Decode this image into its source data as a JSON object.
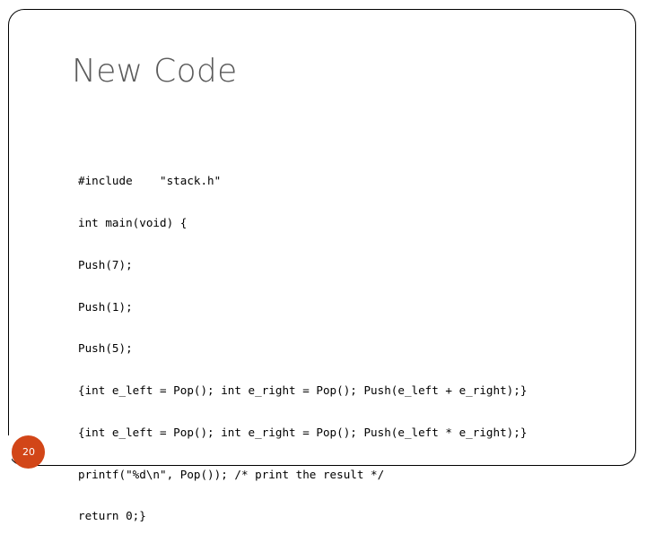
{
  "slide": {
    "title": "New Code",
    "page_number": "20",
    "accent_color": "#D24618",
    "title_color": "#5a5a5a",
    "background_color": "#ffffff",
    "border_color": "#000000"
  },
  "code": {
    "language": "c",
    "lines": [
      "#include    \"stack.h\"",
      "int main(void) {",
      "Push(7);",
      "Push(1);",
      "Push(5);",
      "{int e_left = Pop(); int e_right = Pop(); Push(e_left + e_right);}",
      "{int e_left = Pop(); int e_right = Pop(); Push(e_left * e_right);}",
      "printf(\"%d\\n\", Pop()); /* print the result */",
      "return 0;}"
    ]
  }
}
